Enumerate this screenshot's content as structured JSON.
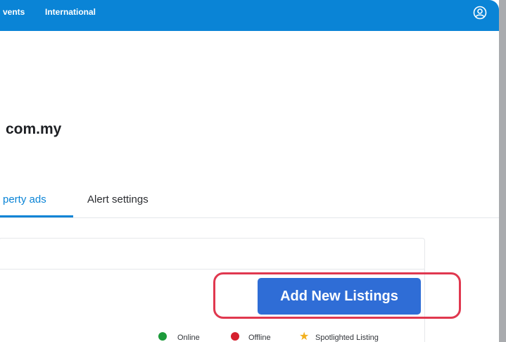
{
  "header": {
    "nav_events": "vents",
    "nav_international": "International",
    "user_icon": "user-circle-icon"
  },
  "page": {
    "domain_text": "com.my"
  },
  "tabs": [
    {
      "label": "perty ads",
      "active": true
    },
    {
      "label": "Alert settings",
      "active": false
    }
  ],
  "actions": {
    "add_new_listings": "Add New Listings"
  },
  "legend": {
    "online": "Online",
    "offline": "Offline",
    "spotlight": "Spotlighted Listing"
  },
  "colors": {
    "brand_blue": "#0a84d6",
    "button_blue": "#2f6dd6",
    "highlight_red": "#e0384f",
    "online_green": "#1c9a3a",
    "offline_red": "#d6202e",
    "star_yellow": "#f2b01e"
  }
}
